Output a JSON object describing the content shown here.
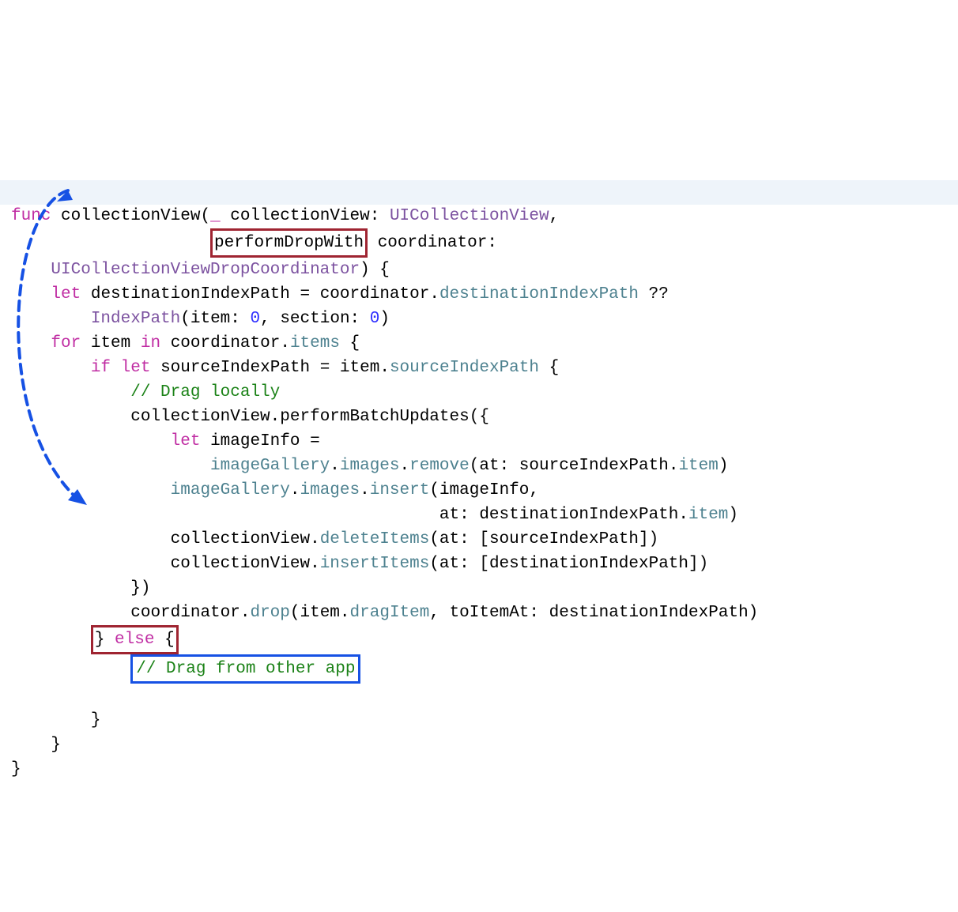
{
  "kw": {
    "func": "func",
    "let": "let",
    "for": "for",
    "in": "in",
    "if": "if",
    "else": "else"
  },
  "id": {
    "collectionView": "collectionView",
    "underscore": "_",
    "coordinator": "coordinator",
    "destinationIndexPath": "destinationIndexPath",
    "sourceIndexPath": "sourceIndexPath",
    "item": "item",
    "performBatchUpdates": "performBatchUpdates",
    "imageInfo": "imageInfo",
    "at_label": "at",
    "toItemAt_label": "toItemAt",
    "section_label": "section"
  },
  "type": {
    "UICollectionView": "UICollectionView",
    "UICollectionViewDropCoordinator": "UICollectionViewDropCoordinator",
    "IndexPath": "IndexPath"
  },
  "mem": {
    "destinationIndexPath": "destinationIndexPath",
    "items": "items",
    "sourceIndexPath": "sourceIndexPath",
    "imageGallery": "imageGallery",
    "images": "images",
    "remove": "remove",
    "item": "item",
    "insert": "insert",
    "deleteItems": "deleteItems",
    "insertItems": "insertItems",
    "drop": "drop",
    "dragItem": "dragItem"
  },
  "num": {
    "zero": "0"
  },
  "label": {
    "performDropWith": "performDropWith"
  },
  "comment": {
    "dragLocally": "// Drag locally",
    "dragOther": "// Drag from other app"
  }
}
